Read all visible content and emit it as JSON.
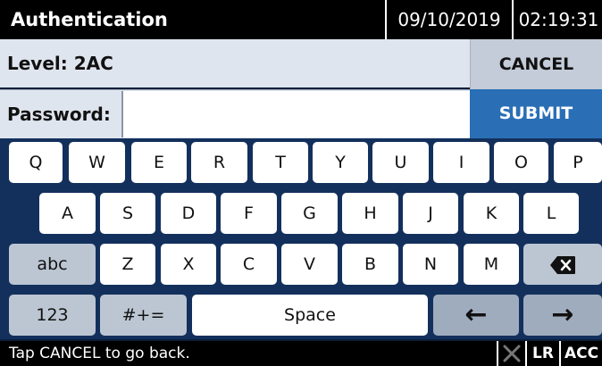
{
  "header": {
    "title": "Authentication",
    "date": "09/10/2019",
    "time": "02:19:31"
  },
  "level": {
    "label": "Level: 2AC",
    "cancel_label": "CANCEL"
  },
  "password": {
    "label": "Password:",
    "value": "",
    "submit_label": "SUBMIT"
  },
  "keyboard": {
    "row1": [
      "Q",
      "W",
      "E",
      "R",
      "T",
      "Y",
      "U",
      "I",
      "O",
      "P"
    ],
    "row2": [
      "A",
      "S",
      "D",
      "F",
      "G",
      "H",
      "J",
      "K",
      "L"
    ],
    "row3": [
      "abc",
      "Z",
      "X",
      "C",
      "V",
      "B",
      "N",
      "M"
    ],
    "row4": {
      "numbers": "123",
      "symbols": "#+=",
      "space": "Space",
      "left_arrow": "←",
      "right_arrow": "→"
    },
    "backspace_icon": "backspace-icon"
  },
  "status": {
    "message": "Tap CANCEL to go back.",
    "tool_icon": "wrench-cross-icon",
    "lr": "LR",
    "acc": "ACC"
  }
}
